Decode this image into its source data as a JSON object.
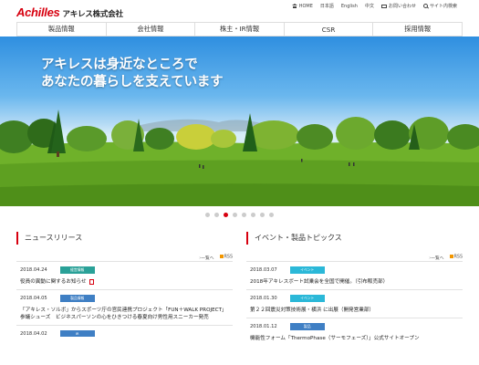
{
  "header": {
    "logo_mark": "Achilles",
    "logo_jp": "アキレス株式会社",
    "utility": [
      {
        "label": "HOME",
        "icon": "home-icon"
      },
      {
        "label": "日本語",
        "icon": ""
      },
      {
        "label": "English",
        "icon": ""
      },
      {
        "label": "中文",
        "icon": ""
      },
      {
        "label": "お問い合わせ",
        "icon": "mail-icon"
      },
      {
        "label": "サイト内検索",
        "icon": "search-icon"
      }
    ]
  },
  "nav": {
    "items": [
      "製品情報",
      "会社情報",
      "株主・IR情報",
      "CSR",
      "採用情報"
    ]
  },
  "hero": {
    "line1": "アキレスは身近なところで",
    "line2": "あなたの暮らしを支えています",
    "slide_count": 8,
    "active_slide": 3
  },
  "news": {
    "title": "ニュースリリース",
    "list_link": "一覧へ",
    "rss": "RSS",
    "entries": [
      {
        "date": "2018.04.24",
        "badge": "経営情報",
        "badge_color": "#2aa198",
        "title": "役員の異動に関するお知らせ",
        "pdf": true
      },
      {
        "date": "2018.04.05",
        "badge": "製品情報",
        "badge_color": "#3f7fc4",
        "title": "「アキレス・ソルボ」からスポーツ庁の官民連携プロジェクト「FUN＋WALK PROJECT」参議シューズ　ビジネスパーソンの心をひきつける春夏向け男性用スニーカー発売",
        "pdf": false
      },
      {
        "date": "2018.04.02",
        "badge": "IR",
        "badge_color": "#3f7fc4",
        "title": "",
        "pdf": false
      }
    ]
  },
  "topics": {
    "title": "イベント・製品トピックス",
    "list_link": "一覧へ",
    "rss": "RSS",
    "entries": [
      {
        "date": "2018.03.07",
        "badge": "イベント",
        "badge_color": "#2bb8d8",
        "title": "2018年アキレスボート試乗会を全国で開催。（引布販売部）"
      },
      {
        "date": "2018.01.30",
        "badge": "イベント",
        "badge_color": "#2bb8d8",
        "title": "第２２回震災対策技術展・横浜 に出展（開発営業部）"
      },
      {
        "date": "2018.01.12",
        "badge": "製品",
        "badge_color": "#3f7fc4",
        "title": "機能性フォーム「ThermoPhase（サーモフェーズ）」公式サイトオープン"
      }
    ]
  }
}
